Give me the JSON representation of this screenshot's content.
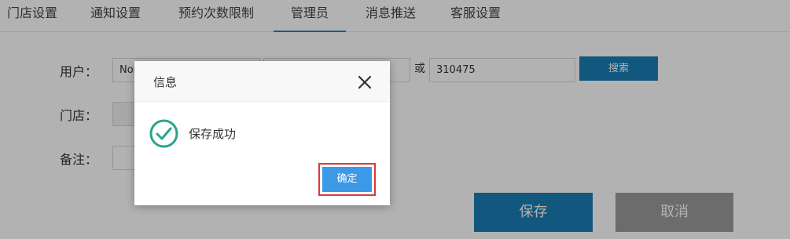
{
  "tabs": [
    {
      "label": "门店设置"
    },
    {
      "label": "通知设置"
    },
    {
      "label": "预约次数限制"
    },
    {
      "label": "管理员",
      "active": true
    },
    {
      "label": "消息推送"
    },
    {
      "label": "客服设置"
    }
  ],
  "form": {
    "user_label": "用户：",
    "user_input_1": "Non",
    "user_input_2": "",
    "or_label": "或",
    "user_input_3": "310475",
    "search_label": "搜索",
    "store_label": "门店：",
    "store_input": "",
    "note_label": "备注：",
    "note_input": "",
    "save_label": "保存",
    "cancel_label": "取消"
  },
  "dialog": {
    "title": "信息",
    "message": "保存成功",
    "ok_label": "确定"
  },
  "colors": {
    "accent": "#1a7eb5",
    "ok_button": "#3b99e6",
    "highlight_border": "#d9383a",
    "success_icon": "#2aa58a",
    "cancel_button": "#9b9b9b"
  },
  "icons": {
    "close": "close-icon",
    "success": "check-circle-icon"
  }
}
